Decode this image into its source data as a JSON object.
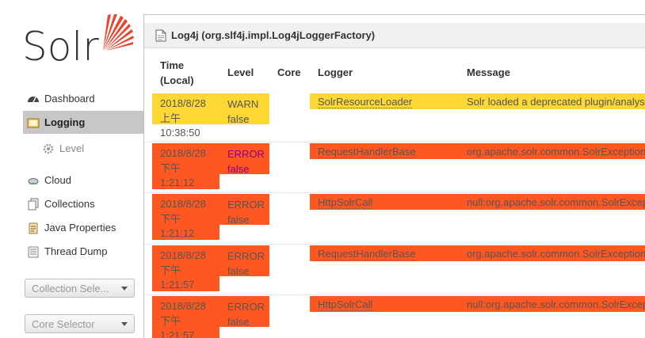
{
  "logo": {
    "text": "Solr"
  },
  "sidebar": {
    "items": [
      {
        "label": "Dashboard",
        "icon": "dashboard-icon"
      },
      {
        "label": "Logging",
        "icon": "logging-icon",
        "active": true
      },
      {
        "label": "Level",
        "icon": "level-gear-icon",
        "sub": true
      },
      {
        "label": "Cloud",
        "icon": "cloud-icon"
      },
      {
        "label": "Collections",
        "icon": "collections-icon"
      },
      {
        "label": "Java Properties",
        "icon": "java-properties-icon"
      },
      {
        "label": "Thread Dump",
        "icon": "thread-dump-icon"
      }
    ],
    "collection_selector": "Collection Sele...",
    "core_selector": "Core Selector"
  },
  "main": {
    "title": "Log4j (org.slf4j.impl.Log4jLoggerFactory)",
    "headers": {
      "time_1": "Time",
      "time_2": "(Local)",
      "level": "Level",
      "core": "Core",
      "logger": "Logger",
      "message": "Message"
    },
    "rows": [
      {
        "date": "2018/8/28",
        "ampm": "上午",
        "time": "10:38:50",
        "level": "WARN",
        "flag": "false",
        "core": "",
        "logger": "SolrResourceLoader",
        "message": "Solr loaded a deprecated plugin/analysis"
      },
      {
        "date": "2018/8/28",
        "ampm": "下午",
        "time": "1:21:12",
        "level": "ERROR",
        "flag": "false",
        "core": "",
        "logger": "RequestHandlerBase",
        "message": "org.apache.solr.common.SolrException"
      },
      {
        "date": "2018/8/28",
        "ampm": "下午",
        "time": "1:21:12",
        "level": "ERROR",
        "flag": "false",
        "core": "",
        "logger": "HttpSolrCall",
        "message": "null:org.apache.solr.common.SolrException"
      },
      {
        "date": "2018/8/28",
        "ampm": "下午",
        "time": "1:21:57",
        "level": "ERROR",
        "flag": "false",
        "core": "",
        "logger": "RequestHandlerBase",
        "message": "org.apache.solr.common.SolrException"
      },
      {
        "date": "2018/8/28",
        "ampm": "下午",
        "time": "1:21:57",
        "level": "ERROR",
        "flag": "false",
        "core": "",
        "logger": "HttpSolrCall",
        "message": "null:org.apache.solr.common.SolrException"
      }
    ]
  },
  "colors": {
    "warn": "#fdd835",
    "error": "#ff5722",
    "logo_orange": "#e8452c",
    "active_nav": "#c7c7c7",
    "error_label_highlight": "#8b008b"
  }
}
